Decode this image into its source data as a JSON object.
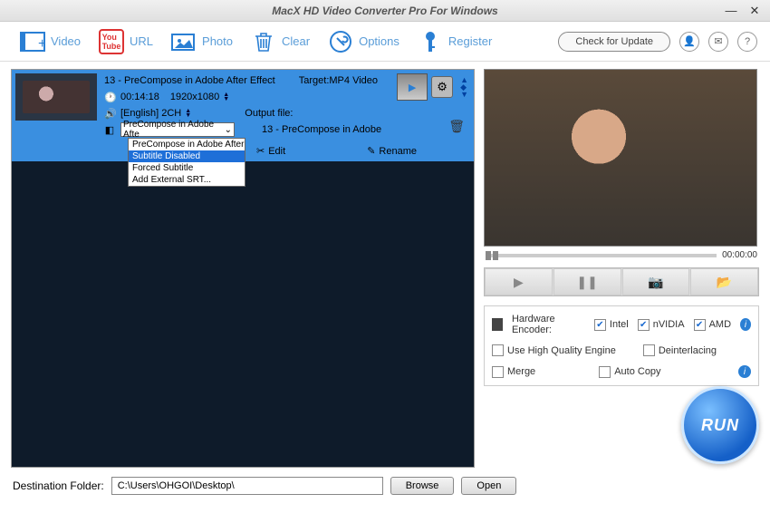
{
  "titlebar": {
    "title": "MacX HD Video Converter Pro For Windows"
  },
  "toolbar": {
    "video": "Video",
    "url": "URL",
    "photo": "Photo",
    "clear": "Clear",
    "options": "Options",
    "register": "Register",
    "update": "Check for Update"
  },
  "file": {
    "title": "13 - PreCompose in Adobe After Effect",
    "target_label": "Target:",
    "target": "MP4 Video",
    "duration": "00:14:18",
    "resolution": "1920x1080",
    "audio": "[English] 2CH",
    "subtitle_selected": "PreCompose in Adobe Afte",
    "subtitle_options": [
      "PreCompose in Adobe After Ef",
      "Subtitle Disabled",
      "Forced Subtitle",
      "Add External SRT..."
    ],
    "output_label": "Output file:",
    "output_name": "13 - PreCompose in Adobe",
    "edit": "Edit",
    "rename": "Rename"
  },
  "preview": {
    "time": "00:00:00"
  },
  "opts": {
    "hw_label": "Hardware Encoder:",
    "intel": "Intel",
    "nvidia": "nVIDIA",
    "amd": "AMD",
    "hq": "Use High Quality Engine",
    "deint": "Deinterlacing",
    "merge": "Merge",
    "autocopy": "Auto Copy"
  },
  "run": "RUN",
  "footer": {
    "label": "Destination Folder:",
    "path": "C:\\Users\\OHGOI\\Desktop\\",
    "browse": "Browse",
    "open": "Open"
  }
}
